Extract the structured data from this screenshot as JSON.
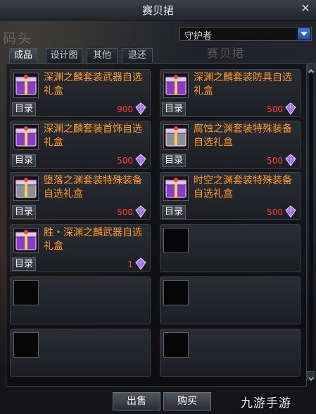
{
  "window": {
    "title": "赛贝捃",
    "close_glyph": "✕"
  },
  "background_text": {
    "top_left": "码头",
    "center": "赛贝捃"
  },
  "filter": {
    "selected": "守护者"
  },
  "tabs": [
    {
      "label": "成品",
      "active": true
    },
    {
      "label": "设计图",
      "active": false
    },
    {
      "label": "其他",
      "active": false
    },
    {
      "label": "退还",
      "active": false
    }
  ],
  "items": [
    {
      "name": "深渊之麟套装武器自选礼盒",
      "catalog": "目录",
      "price": "900",
      "icon": "purple-gift-box-icon",
      "accent": "#8a3cc8"
    },
    {
      "name": "深渊之麟套装防具自选礼盒",
      "catalog": "目录",
      "price": "500",
      "icon": "purple-gift-box-icon",
      "accent": "#8a3cc8"
    },
    {
      "name": "深渊之麟套装首饰自选礼盒",
      "catalog": "目录",
      "price": "500",
      "icon": "purple-gift-box-icon",
      "accent": "#8a3cc8"
    },
    {
      "name": "腐蚀之渊套装特殊装备自选礼盒",
      "catalog": "目录",
      "price": "500",
      "icon": "gray-gift-box-icon",
      "accent": "#8c8f95"
    },
    {
      "name": "堕落之渊套装特殊装备自选礼盒",
      "catalog": "目录",
      "price": "500",
      "icon": "gray-gift-box-icon",
      "accent": "#8c8f95"
    },
    {
      "name": "时空之渊套装特殊装备自选礼盒",
      "catalog": "目录",
      "price": "500",
      "icon": "purple-gift-box-icon",
      "accent": "#8a3cc8"
    },
    {
      "name": "胜・深渊之麟武器自选礼盒",
      "catalog": "目录",
      "price": "1",
      "icon": "purple-gift-box-icon",
      "accent": "#8a3cc8"
    }
  ],
  "buttons": {
    "sell": "出售",
    "buy": "购买"
  },
  "watermark": "九游手游"
}
